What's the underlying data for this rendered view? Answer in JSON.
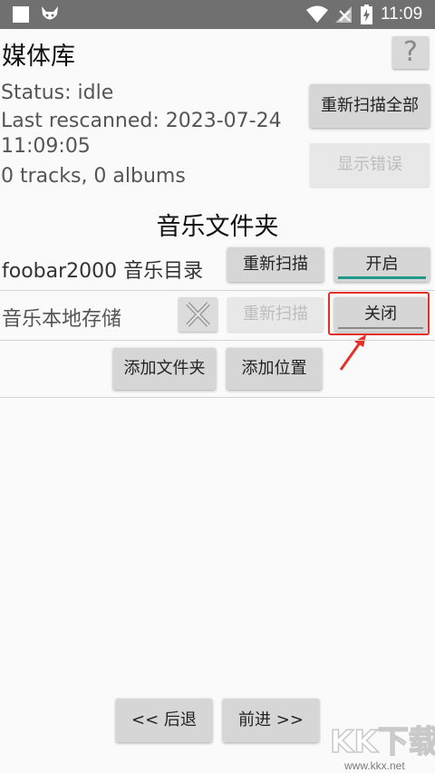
{
  "statusbar": {
    "time": "11:09"
  },
  "header": {
    "title": "媒体库",
    "help_label": "?"
  },
  "library": {
    "status": "Status: idle",
    "last_rescanned": "Last rescanned: 2023-07-24",
    "last_rescanned_time": "11:09:05",
    "counts": "0 tracks, 0 albums",
    "rescan_all_label": "重新扫描全部",
    "show_errors_label": "显示错误"
  },
  "folders": {
    "section_title": "音乐文件夹",
    "rows": [
      {
        "name": "foobar2000 音乐目录",
        "rescan_label": "重新扫描",
        "toggle_label": "开启"
      },
      {
        "name": "音乐本地存储",
        "rescan_label": "重新扫描",
        "toggle_label": "关闭"
      }
    ],
    "add_folder_label": "添加文件夹",
    "add_location_label": "添加位置"
  },
  "navigation": {
    "back_label": "<< 后退",
    "forward_label": "前进 >>"
  },
  "watermark": {
    "brand": "KK下载",
    "url": "www.kkx.net"
  },
  "colors": {
    "statusbar": "#707070",
    "accent": "#1e9a8a",
    "highlight": "#e5302a"
  }
}
